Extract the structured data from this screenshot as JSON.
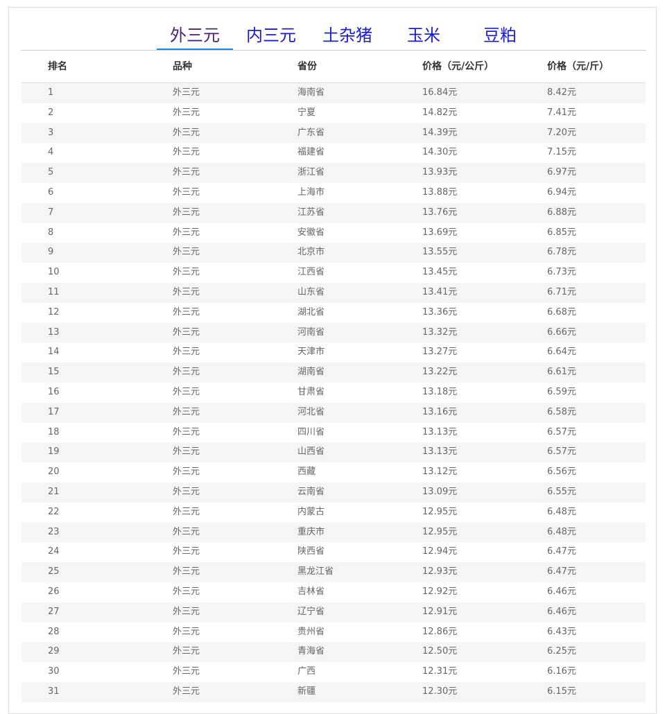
{
  "tabs": [
    {
      "label": "外三元",
      "active": true
    },
    {
      "label": "内三元",
      "active": false
    },
    {
      "label": "土杂猪",
      "active": false
    },
    {
      "label": "玉米",
      "active": false
    },
    {
      "label": "豆粕",
      "active": false
    }
  ],
  "table": {
    "headers": [
      "排名",
      "品种",
      "省份",
      "价格（元/公斤）",
      "价格（元/斤）"
    ],
    "rows": [
      [
        "1",
        "外三元",
        "海南省",
        "16.84元",
        "8.42元"
      ],
      [
        "2",
        "外三元",
        "宁夏",
        "14.82元",
        "7.41元"
      ],
      [
        "3",
        "外三元",
        "广东省",
        "14.39元",
        "7.20元"
      ],
      [
        "4",
        "外三元",
        "福建省",
        "14.30元",
        "7.15元"
      ],
      [
        "5",
        "外三元",
        "浙江省",
        "13.93元",
        "6.97元"
      ],
      [
        "6",
        "外三元",
        "上海市",
        "13.88元",
        "6.94元"
      ],
      [
        "7",
        "外三元",
        "江苏省",
        "13.76元",
        "6.88元"
      ],
      [
        "8",
        "外三元",
        "安徽省",
        "13.69元",
        "6.85元"
      ],
      [
        "9",
        "外三元",
        "北京市",
        "13.55元",
        "6.78元"
      ],
      [
        "10",
        "外三元",
        "江西省",
        "13.45元",
        "6.73元"
      ],
      [
        "11",
        "外三元",
        "山东省",
        "13.41元",
        "6.71元"
      ],
      [
        "12",
        "外三元",
        "湖北省",
        "13.36元",
        "6.68元"
      ],
      [
        "13",
        "外三元",
        "河南省",
        "13.32元",
        "6.66元"
      ],
      [
        "14",
        "外三元",
        "天津市",
        "13.27元",
        "6.64元"
      ],
      [
        "15",
        "外三元",
        "湖南省",
        "13.22元",
        "6.61元"
      ],
      [
        "16",
        "外三元",
        "甘肃省",
        "13.18元",
        "6.59元"
      ],
      [
        "17",
        "外三元",
        "河北省",
        "13.16元",
        "6.58元"
      ],
      [
        "18",
        "外三元",
        "四川省",
        "13.13元",
        "6.57元"
      ],
      [
        "19",
        "外三元",
        "山西省",
        "13.13元",
        "6.57元"
      ],
      [
        "20",
        "外三元",
        "西藏",
        "13.12元",
        "6.56元"
      ],
      [
        "21",
        "外三元",
        "云南省",
        "13.09元",
        "6.55元"
      ],
      [
        "22",
        "外三元",
        "内蒙古",
        "12.95元",
        "6.48元"
      ],
      [
        "23",
        "外三元",
        "重庆市",
        "12.95元",
        "6.48元"
      ],
      [
        "24",
        "外三元",
        "陕西省",
        "12.94元",
        "6.47元"
      ],
      [
        "25",
        "外三元",
        "黑龙江省",
        "12.93元",
        "6.47元"
      ],
      [
        "26",
        "外三元",
        "吉林省",
        "12.92元",
        "6.46元"
      ],
      [
        "27",
        "外三元",
        "辽宁省",
        "12.91元",
        "6.46元"
      ],
      [
        "28",
        "外三元",
        "贵州省",
        "12.86元",
        "6.43元"
      ],
      [
        "29",
        "外三元",
        "青海省",
        "12.50元",
        "6.25元"
      ],
      [
        "30",
        "外三元",
        "广西",
        "12.31元",
        "6.16元"
      ],
      [
        "31",
        "外三元",
        "新疆",
        "12.30元",
        "6.15元"
      ]
    ]
  },
  "colors": {
    "tab_text": "#1a1adb",
    "tab_active_text": "#4b1f78",
    "tab_underline": "#1e88e5",
    "row_stripe": "#f5f5f5"
  }
}
